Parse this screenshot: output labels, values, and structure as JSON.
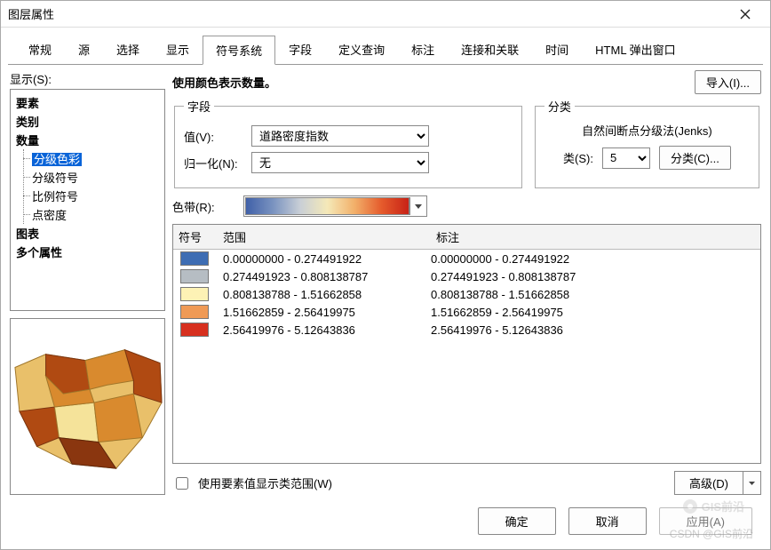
{
  "window": {
    "title": "图层属性"
  },
  "tabs": [
    "常规",
    "源",
    "选择",
    "显示",
    "符号系统",
    "字段",
    "定义查询",
    "标注",
    "连接和关联",
    "时间",
    "HTML 弹出窗口"
  ],
  "left": {
    "show_label": "显示(S):",
    "tree": [
      "要素",
      "类别",
      "数量",
      "图表",
      "多个属性"
    ],
    "tree_sub": [
      "分级色彩",
      "分级符号",
      "比例符号",
      "点密度"
    ]
  },
  "right": {
    "description": "使用颜色表示数量。",
    "import_btn": "导入(I)...",
    "field_legend": "字段",
    "value_label": "值(V):",
    "value_field": "道路密度指数",
    "norm_label": "归一化(N):",
    "norm_value": "无",
    "class_legend": "分类",
    "class_method": "自然间断点分级法(Jenks)",
    "classes_label": "类(S):",
    "classes_count": "5",
    "classify_btn": "分类(C)...",
    "ramp_label": "色带(R):",
    "show_range_label": "使用要素值显示类范围(W)",
    "advanced_btn": "高级(D)"
  },
  "grid": {
    "cols": [
      "符号",
      "范围",
      "标注"
    ],
    "rows": [
      {
        "color": "#3e6db3",
        "range": "0.00000000 - 0.274491922",
        "label": "0.00000000 - 0.274491922"
      },
      {
        "color": "#b6bdc3",
        "range": "0.274491923 - 0.808138787",
        "label": "0.274491923 - 0.808138787"
      },
      {
        "color": "#fdf2b5",
        "range": "0.808138788 - 1.51662858",
        "label": "0.808138788 - 1.51662858"
      },
      {
        "color": "#ef9a56",
        "range": "1.51662859 - 2.56419975",
        "label": "1.51662859 - 2.56419975"
      },
      {
        "color": "#d7301f",
        "range": "2.56419976 - 5.12643836",
        "label": "2.56419976 - 5.12643836"
      }
    ]
  },
  "footer": {
    "ok": "确定",
    "cancel": "取消",
    "apply": "应用(A)"
  },
  "watermark": {
    "brand": "GIS前沿",
    "text": "CSDN @GIS前沿"
  }
}
